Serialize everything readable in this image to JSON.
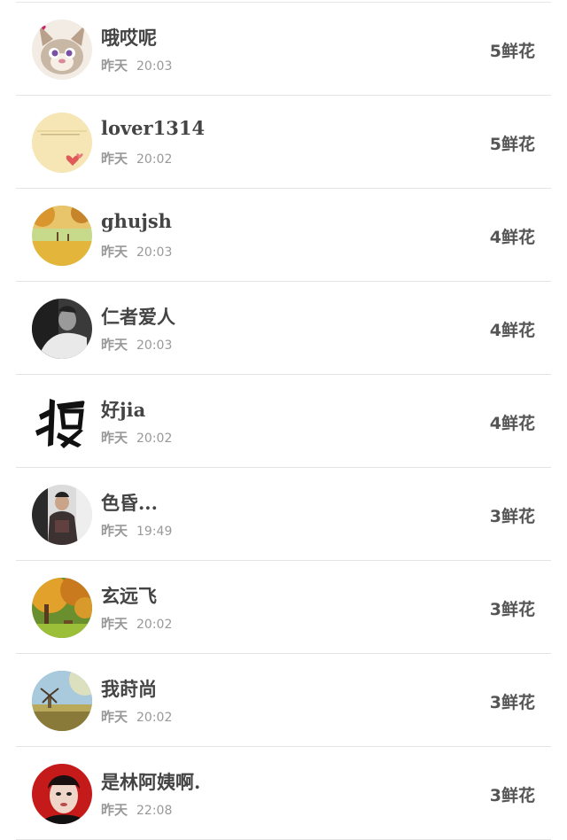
{
  "rows": [
    {
      "name": "哦哎呢",
      "day": "昨天",
      "time": "20:03",
      "flowers": "5鲜花",
      "avatar": "fox-avatar"
    },
    {
      "name": "lover1314",
      "day": "昨天",
      "time": "20:02",
      "flowers": "5鲜花",
      "avatar": "heart-avatar"
    },
    {
      "name": "ghujsh",
      "day": "昨天",
      "time": "20:03",
      "flowers": "4鲜花",
      "avatar": "autumn-field-avatar"
    },
    {
      "name": "仁者爱人",
      "day": "昨天",
      "time": "20:03",
      "flowers": "4鲜花",
      "avatar": "man-bw-avatar"
    },
    {
      "name": "好jia",
      "day": "昨天",
      "time": "20:02",
      "flowers": "4鲜花",
      "avatar": "calligraphy-avatar"
    },
    {
      "name": "色昏...",
      "day": "昨天",
      "time": "19:49",
      "flowers": "3鲜花",
      "avatar": "person-avatar"
    },
    {
      "name": "玄远飞",
      "day": "昨天",
      "time": "20:02",
      "flowers": "3鲜花",
      "avatar": "autumn-tree-avatar"
    },
    {
      "name": "我莳尚",
      "day": "昨天",
      "time": "20:02",
      "flowers": "3鲜花",
      "avatar": "windmill-avatar"
    },
    {
      "name": "是林阿姨啊.",
      "day": "昨天",
      "time": "22:08",
      "flowers": "3鲜花",
      "avatar": "red-portrait-avatar"
    }
  ]
}
